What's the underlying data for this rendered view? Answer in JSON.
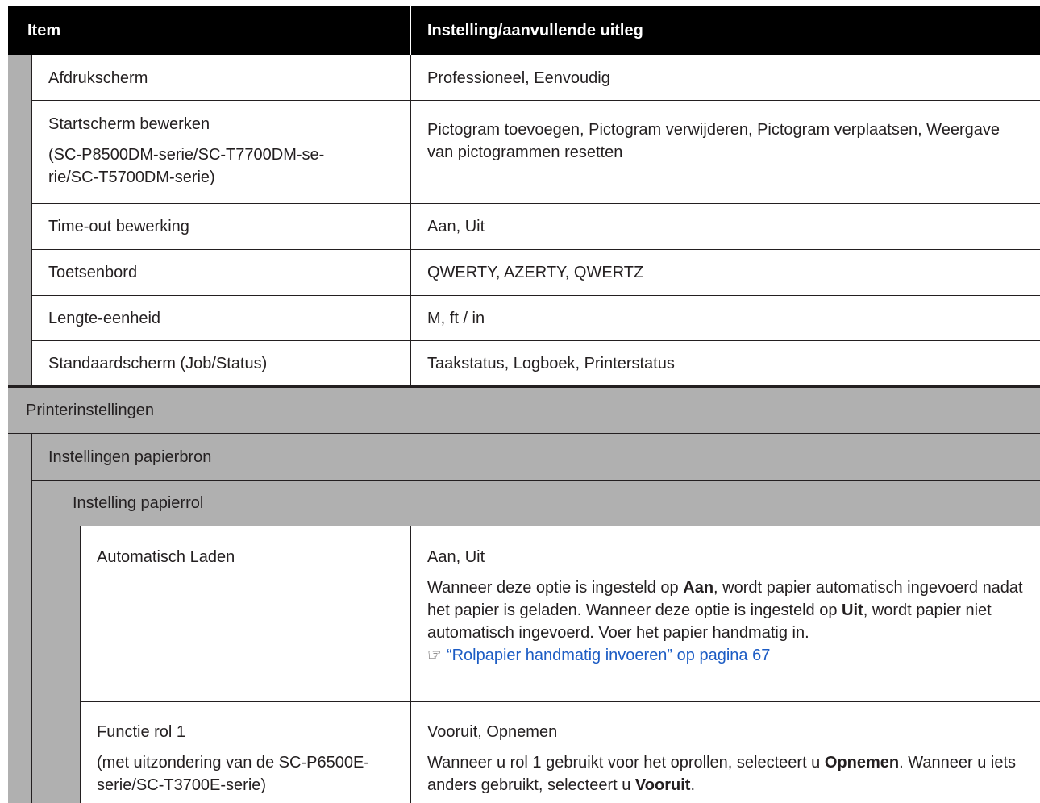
{
  "header": {
    "col_item": "Item",
    "col_setting": "Instelling/aanvullende uitleg"
  },
  "rows": {
    "afdrukscherm": {
      "item": "Afdrukscherm",
      "setting": "Professioneel, Eenvoudig"
    },
    "startscherm": {
      "item": "Startscherm bewerken",
      "item_note": "(SC-P8500DM-serie/SC-T7700DM-se-rie/SC-T5700DM-serie)",
      "setting": "Pictogram toevoegen, Pictogram verwijderen, Pictogram verplaatsen, Weergave van pictogrammen resetten"
    },
    "timeout": {
      "item": "Time-out bewerking",
      "setting": "Aan, Uit"
    },
    "toetsenbord": {
      "item": "Toetsenbord",
      "setting": "QWERTY, AZERTY, QWERTZ"
    },
    "lengte": {
      "item": "Lengte-eenheid",
      "setting": "M, ft / in"
    },
    "standaardscherm": {
      "item": "Standaardscherm (Job/Status)",
      "setting": "Taakstatus, Logboek, Printerstatus"
    },
    "printerinstellingen": {
      "item": "Printerinstellingen"
    },
    "papierbron": {
      "item": "Instellingen papierbron"
    },
    "papierrol": {
      "item": "Instelling papierrol"
    },
    "autoladen": {
      "item": "Automatisch Laden",
      "setting": "Aan, Uit",
      "desc_1": "Wanneer deze optie is ingesteld op ",
      "desc_bold_1": "Aan",
      "desc_2": ", wordt papier automatisch ingevoerd nadat het papier is geladen. Wanneer deze optie is ingesteld op ",
      "desc_bold_2": "Uit",
      "desc_3": ", wordt papier niet automatisch ingevoerd. Voer het papier handmatig in.",
      "ref_icon": "reference-hand-icon",
      "ref_text": "“Rolpapier handmatig invoeren” op pagina 67"
    },
    "functierol": {
      "item": "Functie rol 1",
      "item_note": "(met uitzondering van de SC-P6500E-serie/SC-T3700E-serie)",
      "setting": "Vooruit, Opnemen",
      "desc_1": "Wanneer u rol 1 gebruikt voor het oprollen, selecteert u ",
      "desc_bold_1": "Opnemen",
      "desc_2": ". Wanneer u iets anders gebruikt, selecteert u ",
      "desc_bold_2": "Vooruit",
      "desc_3": "."
    }
  },
  "colors": {
    "header_bg": "#000000",
    "group_bg": "#b0b0b0",
    "link": "#1c5cc4",
    "border": "#231f20"
  }
}
